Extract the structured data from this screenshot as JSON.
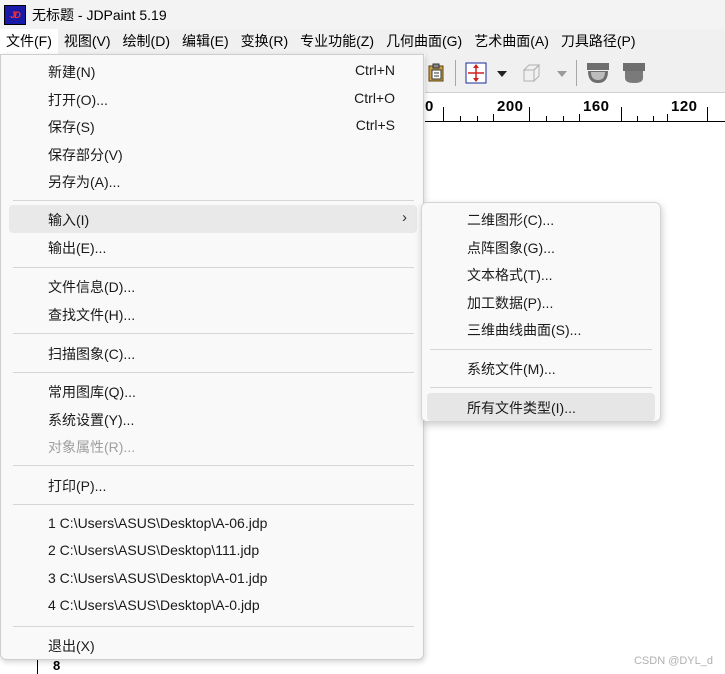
{
  "window": {
    "app_icon": "JD",
    "title": "无标题 - JDPaint 5.19"
  },
  "menubar": [
    {
      "label": "文件(F)",
      "active": true
    },
    {
      "label": "视图(V)"
    },
    {
      "label": "绘制(D)"
    },
    {
      "label": "编辑(E)"
    },
    {
      "label": "变换(R)"
    },
    {
      "label": "专业功能(Z)"
    },
    {
      "label": "几何曲面(G)"
    },
    {
      "label": "艺术曲面(A)"
    },
    {
      "label": "刀具路径(P)"
    }
  ],
  "toolbar": {
    "icons": [
      "paste-icon",
      "axis-arrows-icon",
      "dropdown-arrow-icon",
      "cube-view-icon",
      "dropdown-arrow-icon",
      "hemisphere-icon",
      "cylinder-tool-icon"
    ]
  },
  "ruler": {
    "labels": [
      "0",
      "200",
      "160",
      "120"
    ]
  },
  "left_ruler": {
    "number": "8"
  },
  "file_menu": {
    "items": [
      {
        "label": "新建(N)",
        "shortcut": "Ctrl+N"
      },
      {
        "label": "打开(O)...",
        "shortcut": "Ctrl+O"
      },
      {
        "label": "保存(S)",
        "shortcut": "Ctrl+S"
      },
      {
        "label": "保存部分(V)"
      },
      {
        "label": "另存为(A)..."
      },
      {
        "label": "输入(I)",
        "submenu": true,
        "highlighted": true
      },
      {
        "label": "输出(E)..."
      },
      {
        "label": "文件信息(D)..."
      },
      {
        "label": "查找文件(H)..."
      },
      {
        "label": "扫描图象(C)..."
      },
      {
        "label": "常用图库(Q)..."
      },
      {
        "label": "系统设置(Y)..."
      },
      {
        "label": "对象属性(R)...",
        "disabled": true
      },
      {
        "label": "打印(P)..."
      },
      {
        "label": "1 C:\\Users\\ASUS\\Desktop\\A-06.jdp"
      },
      {
        "label": "2 C:\\Users\\ASUS\\Desktop\\111.jdp"
      },
      {
        "label": "3 C:\\Users\\ASUS\\Desktop\\A-01.jdp"
      },
      {
        "label": "4 C:\\Users\\ASUS\\Desktop\\A-0.jdp"
      },
      {
        "label": "退出(X)"
      }
    ]
  },
  "import_submenu": {
    "items": [
      {
        "label": "二维图形(C)..."
      },
      {
        "label": "点阵图象(G)..."
      },
      {
        "label": "文本格式(T)..."
      },
      {
        "label": "加工数据(P)..."
      },
      {
        "label": "三维曲线曲面(S)..."
      },
      {
        "label": "系统文件(M)..."
      },
      {
        "label": "所有文件类型(I)...",
        "highlighted": true
      }
    ]
  },
  "watermark": "CSDN @DYL_d",
  "colors": {
    "menu_bg": "#f9f9f9",
    "highlight": "#e9e9e9",
    "disabled_text": "#a0a0a0",
    "toolbar_accent": "#d02020"
  }
}
